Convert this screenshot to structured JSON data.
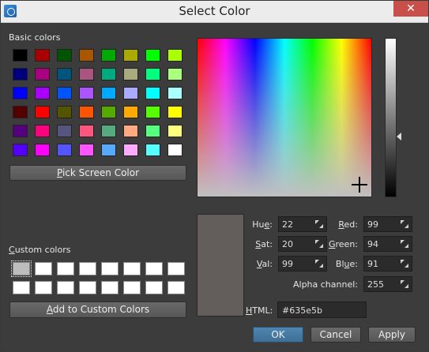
{
  "window": {
    "title": "Select Color",
    "close_label": "✕"
  },
  "basic": {
    "label": "Basic colors",
    "colors": [
      "#000000",
      "#aa0000",
      "#005500",
      "#aa5500",
      "#00aa00",
      "#aaaa00",
      "#00ff00",
      "#aaff00",
      "#00007f",
      "#aa007f",
      "#00557f",
      "#aa557f",
      "#00aa7f",
      "#aaaa7f",
      "#00ff7f",
      "#aaff7f",
      "#0000ff",
      "#aa00ff",
      "#0055ff",
      "#aa55ff",
      "#00aaff",
      "#aaaaff",
      "#00ffff",
      "#aaffff",
      "#550000",
      "#ff0000",
      "#555500",
      "#ff5500",
      "#55aa00",
      "#ffaa00",
      "#55ff00",
      "#ffff00",
      "#55007f",
      "#ff007f",
      "#55557f",
      "#ff557f",
      "#55aa7f",
      "#ffaa7f",
      "#55ff7f",
      "#ffff7f",
      "#5500ff",
      "#ff00ff",
      "#5555ff",
      "#ff55ff",
      "#55aaff",
      "#ffaaff",
      "#55ffff",
      "#ffffff"
    ]
  },
  "pick_button": {
    "pre": "",
    "ul": "P",
    "post": "ick Screen Color"
  },
  "custom": {
    "label_ul": "C",
    "label_rest": "ustom colors",
    "colors": [
      "#bdbdbd",
      "#ffffff",
      "#ffffff",
      "#ffffff",
      "#ffffff",
      "#ffffff",
      "#ffffff",
      "#ffffff",
      "#ffffff",
      "#ffffff",
      "#ffffff",
      "#ffffff",
      "#ffffff",
      "#ffffff",
      "#ffffff",
      "#ffffff"
    ]
  },
  "add_button": {
    "ul": "A",
    "rest": "dd to Custom Colors"
  },
  "current_color": "#635e5b",
  "fields": {
    "hue": {
      "label_pre": "Hu",
      "label_ul": "e",
      "label_post": ":",
      "value": "22"
    },
    "sat": {
      "label_pre": "",
      "label_ul": "S",
      "label_post": "at:",
      "value": "20"
    },
    "val": {
      "label_pre": "",
      "label_ul": "V",
      "label_post": "al:",
      "value": "99"
    },
    "red": {
      "label_pre": "",
      "label_ul": "R",
      "label_post": "ed:",
      "value": "99"
    },
    "green": {
      "label_pre": "",
      "label_ul": "G",
      "label_post": "reen:",
      "value": "94"
    },
    "blue": {
      "label_pre": "Bl",
      "label_ul": "u",
      "label_post": "e:",
      "value": "91"
    },
    "alpha": {
      "label": "Alpha channel:",
      "value": "255"
    }
  },
  "html_field": {
    "label_ul": "H",
    "label_rest": "TML:",
    "value": "#635e5b"
  },
  "buttons": {
    "ok": "OK",
    "cancel": "Cancel",
    "apply": "Apply"
  }
}
